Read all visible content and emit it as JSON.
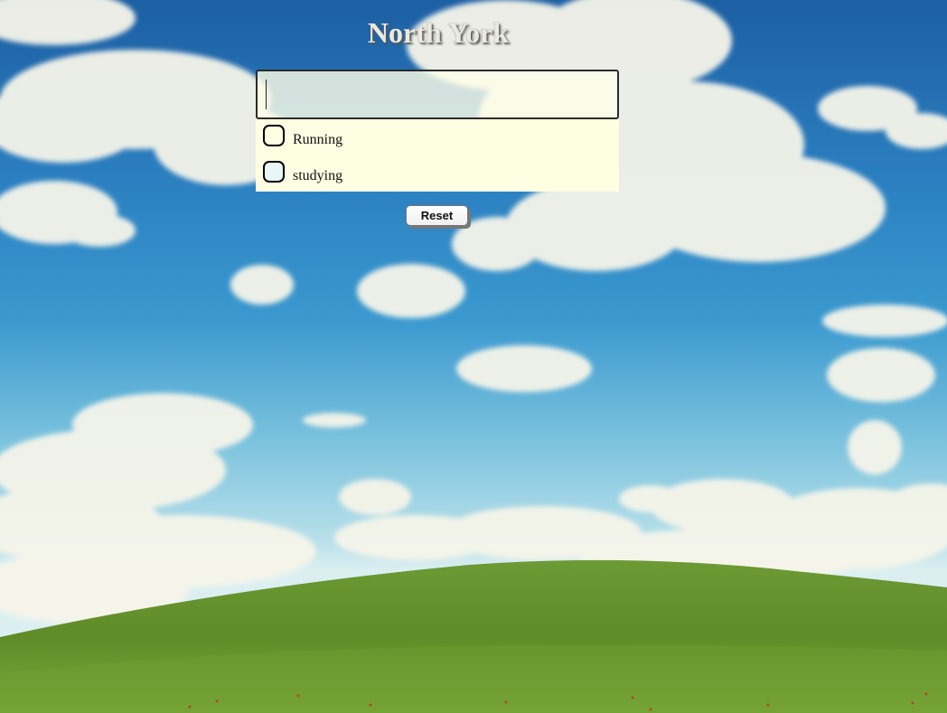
{
  "page": {
    "title": "North York"
  },
  "todo": {
    "input_value": "",
    "items": [
      {
        "label": "Running",
        "checked": false
      },
      {
        "label": "studying",
        "checked": false
      }
    ]
  },
  "controls": {
    "reset_label": "Reset"
  },
  "colors": {
    "sky_top": "#1d5fa3",
    "sky_mid": "#3b99cf",
    "hill_grass": "#5f8f2c",
    "panel_bg": "#fefee2"
  }
}
